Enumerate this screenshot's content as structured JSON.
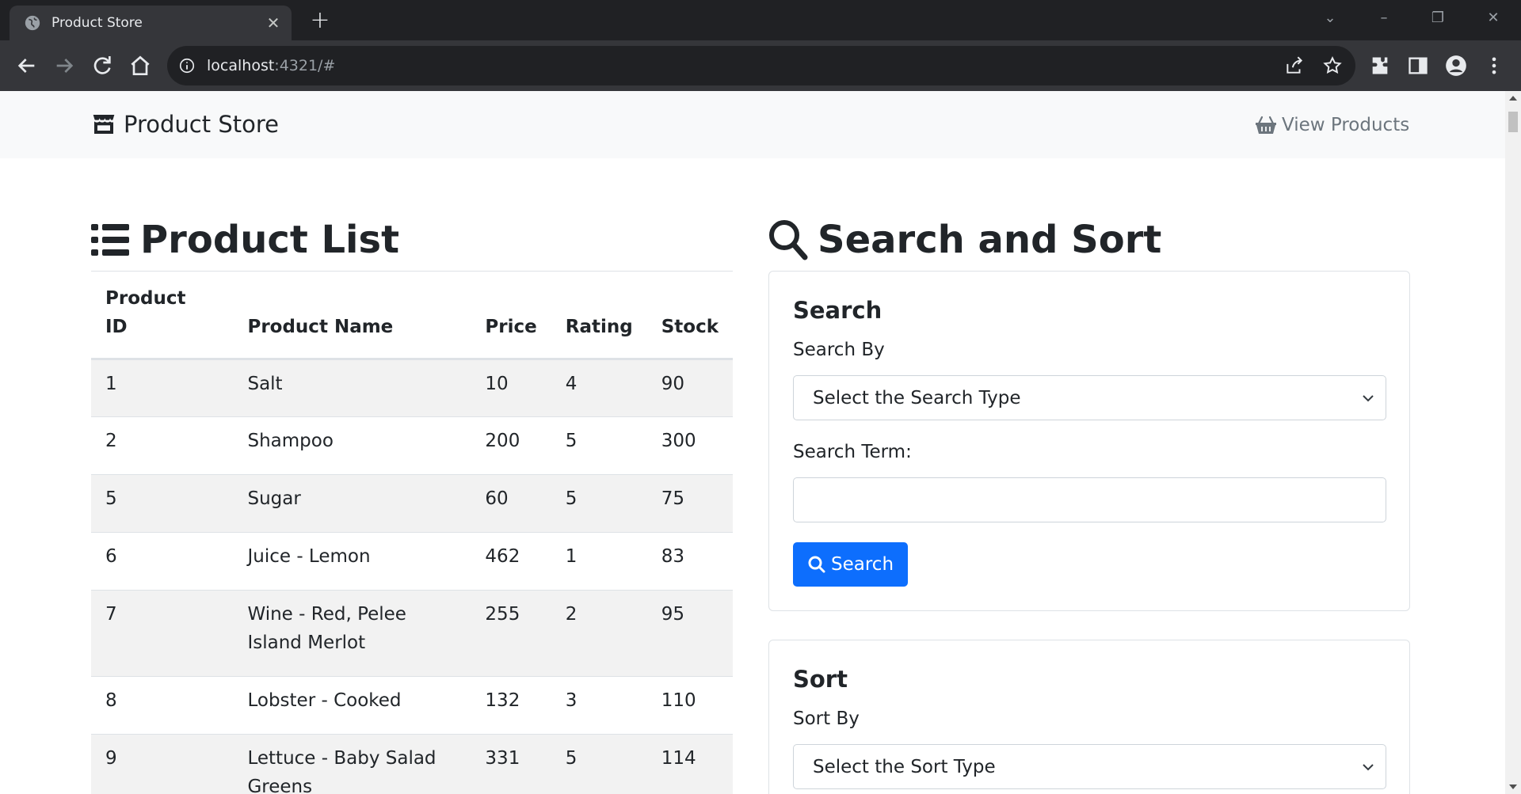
{
  "browser": {
    "tab_title": "Product Store",
    "url_host": "localhost",
    "url_rest": ":4321/#"
  },
  "navbar": {
    "brand": "Product Store",
    "view_products": "View Products"
  },
  "product_list": {
    "title": "Product List",
    "columns": {
      "id": "Product ID",
      "name": "Product Name",
      "price": "Price",
      "rating": "Rating",
      "stock": "Stock"
    },
    "rows": [
      {
        "id": "1",
        "name": "Salt",
        "price": "10",
        "rating": "4",
        "stock": "90"
      },
      {
        "id": "2",
        "name": "Shampoo",
        "price": "200",
        "rating": "5",
        "stock": "300"
      },
      {
        "id": "5",
        "name": "Sugar",
        "price": "60",
        "rating": "5",
        "stock": "75"
      },
      {
        "id": "6",
        "name": "Juice - Lemon",
        "price": "462",
        "rating": "1",
        "stock": "83"
      },
      {
        "id": "7",
        "name": "Wine - Red, Pelee Island Merlot",
        "price": "255",
        "rating": "2",
        "stock": "95"
      },
      {
        "id": "8",
        "name": "Lobster - Cooked",
        "price": "132",
        "rating": "3",
        "stock": "110"
      },
      {
        "id": "9",
        "name": "Lettuce - Baby Salad Greens",
        "price": "331",
        "rating": "5",
        "stock": "114"
      }
    ]
  },
  "search_sort": {
    "title": "Search and Sort",
    "search": {
      "heading": "Search",
      "by_label": "Search By",
      "by_value": "Select the Search Type",
      "term_label": "Search Term:",
      "term_value": "",
      "button": "Search"
    },
    "sort": {
      "heading": "Sort",
      "by_label": "Sort By",
      "by_value": "Select the Sort Type"
    }
  },
  "colors": {
    "primary": "#0d6efd",
    "navbar_bg": "#f8f9fa",
    "stripe": "#f2f2f2",
    "chrome_dark": "#202124",
    "chrome_toolbar": "#35363a"
  }
}
